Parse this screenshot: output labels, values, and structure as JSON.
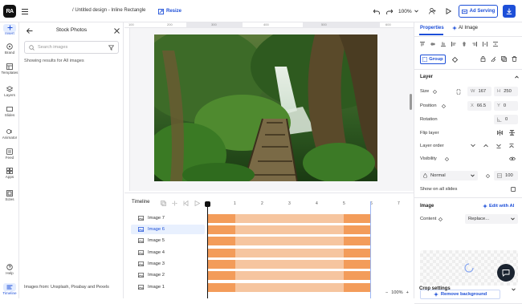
{
  "app": {
    "logo": "RA",
    "title": "/ Untitled design - Inline Rectangle",
    "resize_label": "Resize",
    "zoom": "100%",
    "ad_serving_label": "Ad Serving"
  },
  "rail": {
    "items": [
      {
        "label": "Insert"
      },
      {
        "label": "Brand"
      },
      {
        "label": "Templates"
      },
      {
        "label": "Layers"
      },
      {
        "label": "Slides"
      },
      {
        "label": "Animator"
      },
      {
        "label": "Feed"
      },
      {
        "label": "Apps"
      },
      {
        "label": "Sizes"
      },
      {
        "label": "Help"
      },
      {
        "label": "Timeline"
      }
    ]
  },
  "stock": {
    "title": "Stock Photos",
    "search_placeholder": "Search images",
    "showing": "Showing results for All images",
    "attribution": "Images from: Unsplash, Pixabay and Pexels"
  },
  "ruler": {
    "ticks": [
      "100",
      "200",
      "300",
      "400",
      "500",
      "600"
    ]
  },
  "timeline": {
    "title": "Timeline",
    "ticks": [
      "1",
      "2",
      "3",
      "4",
      "5",
      "6",
      "7"
    ],
    "zoom": "100%",
    "layers": [
      "Image 7",
      "Image 6",
      "Image 5",
      "Image 4",
      "Image 3",
      "Image 2",
      "Image 1"
    ],
    "selected_index": 1
  },
  "props": {
    "tab_properties": "Properties",
    "tab_ai_image": "AI Image",
    "group_label": "Group",
    "layer_title": "Layer",
    "size_label": "Size",
    "w_key": "W",
    "w_val": "167",
    "h_key": "H",
    "h_val": "250",
    "position_label": "Position",
    "x_key": "X",
    "x_val": "66.5",
    "y_key": "Y",
    "y_val": "0",
    "rotation_label": "Rotation",
    "rotation_val": "0",
    "flip_label": "Flip layer",
    "order_label": "Layer order",
    "visibility_label": "Visibility",
    "blend_val": "Normal",
    "opacity_val": "100",
    "show_all_label": "Show on all slides",
    "image_title": "Image",
    "edit_ai_label": "Edit with AI",
    "content_label": "Content",
    "replace_label": "Replace...",
    "remove_bg_label": "Remove background",
    "crop_title": "Crop settings"
  },
  "colors": {
    "accent": "#1d4fd8",
    "track_light": "#f6c59f",
    "track_dark": "#f39c5a"
  }
}
